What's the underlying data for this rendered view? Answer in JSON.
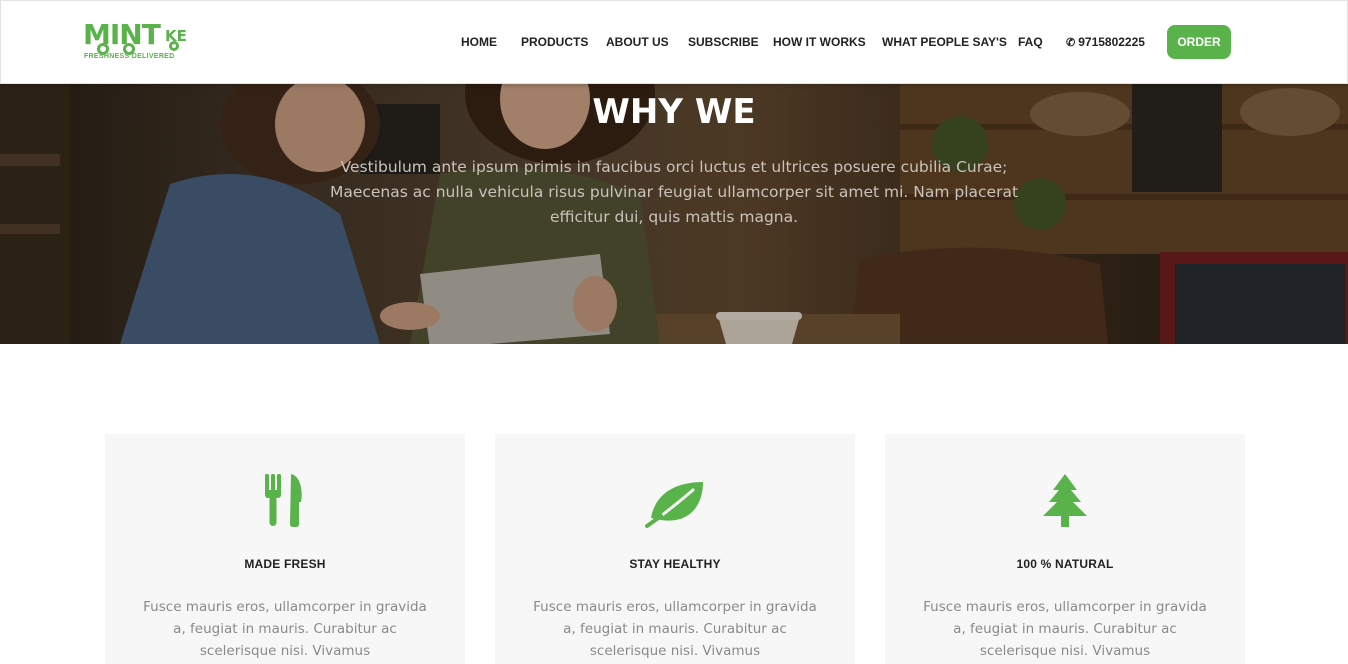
{
  "brand": {
    "name_main": "MINT",
    "name_small": "KE",
    "tagline": "FRESHNESS DELIVERED",
    "color": "#5ab34a"
  },
  "nav": {
    "items": [
      {
        "label": "HOME"
      },
      {
        "label": "PRODUCTS"
      },
      {
        "label": "ABOUT US"
      },
      {
        "label": "SUBSCRIBE"
      },
      {
        "label": "HOW IT WORKS"
      },
      {
        "label": "WHAT PEOPLE SAY'S"
      },
      {
        "label": "FAQ"
      }
    ],
    "phone": "9715802225",
    "phone_icon": "phone-icon",
    "order_label": "ORDER"
  },
  "hero": {
    "title_light": "WHY",
    "title_bold": "WE",
    "text": "Vestibulum ante ipsum primis in faucibus orci luctus et ultrices posuere cubilia Curae; Maecenas ac nulla vehicula risus pulvinar feugiat ullamcorper sit amet mi. Nam placerat efficitur dui, quis mattis magna."
  },
  "features": [
    {
      "icon": "fork-knife-icon",
      "title": "MADE FRESH",
      "text": "Fusce mauris eros, ullamcorper in gravida a, feugiat in mauris. Curabitur ac scelerisque nisi. Vivamus"
    },
    {
      "icon": "leaf-icon",
      "title": "STAY HEALTHY",
      "text": "Fusce mauris eros, ullamcorper in gravida a, feugiat in mauris. Curabitur ac scelerisque nisi. Vivamus"
    },
    {
      "icon": "tree-icon",
      "title": "100 % NATURAL",
      "text": "Fusce mauris eros, ullamcorper in gravida a, feugiat in mauris. Curabitur ac scelerisque nisi. Vivamus"
    }
  ]
}
